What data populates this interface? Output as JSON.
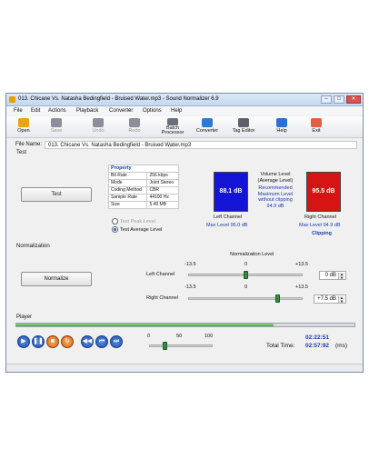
{
  "window": {
    "title": "013. Chicane Vs. Natasha Bedingfield - Bruised Water.mp3 - Sound Normalizer 6.9",
    "controls": [
      "–",
      "□",
      "✕"
    ]
  },
  "menu": [
    "File",
    "Edit",
    "Actions",
    "Playback",
    "Converter",
    "Options",
    "Help"
  ],
  "toolbar": [
    {
      "label": "Open",
      "icon": "folder-open-icon",
      "color": "#e8a317",
      "enabled": true
    },
    {
      "label": "Save",
      "icon": "save-icon",
      "color": "#8a8f99",
      "enabled": false
    },
    {
      "label": "Undo",
      "icon": "undo-icon",
      "color": "#8a8f99",
      "enabled": false
    },
    {
      "label": "Redo",
      "icon": "redo-icon",
      "color": "#8a8f99",
      "enabled": false
    },
    {
      "label": "Batch\nProcessor",
      "icon": "batch-icon",
      "color": "#6a6f7a",
      "enabled": true
    },
    {
      "label": "Converter",
      "icon": "converter-icon",
      "color": "#2b7bd6",
      "enabled": true
    },
    {
      "label": "Tag Editor",
      "icon": "tag-icon",
      "color": "#5a5f6a",
      "enabled": true
    },
    {
      "label": "Help",
      "icon": "help-icon",
      "color": "#2b6fd6",
      "enabled": true
    },
    {
      "label": "Exit",
      "icon": "exit-icon",
      "color": "#e06040",
      "enabled": true
    }
  ],
  "file": {
    "label": "File Name:",
    "value": "013. Chicane Vs. Natasha Bedingfield - Bruised Water.mp3"
  },
  "test": {
    "section": "Test",
    "button": "Test",
    "property_header": "Property",
    "properties": [
      {
        "name": "Bit Rate",
        "value": "256 kbps"
      },
      {
        "name": "Mode",
        "value": "Joint Stereo"
      },
      {
        "name": "Coding Method",
        "value": "CBR"
      },
      {
        "name": "Sample Rate",
        "value": "44100 Hz"
      },
      {
        "name": "Size",
        "value": "5.49 MB"
      }
    ],
    "radio_peak": "Test Peak Level",
    "radio_average": "Test Average Level",
    "left_meter": {
      "value": "88.1 dB",
      "color": "#1414d6",
      "label": "Left Channel",
      "max": "Max Level 95.0 dB"
    },
    "right_meter": {
      "value": "95.5 dB",
      "color": "#d61414",
      "label": "Right Channel",
      "max": "Max Level 94.9 dB",
      "clipping": "Clipping"
    },
    "volume_level": "Volume Level\n(Average Level)",
    "recommended": "Recommended\nMaximum Level\nwithout clipping\n94.9 dB"
  },
  "normalization": {
    "section": "Normalization",
    "button": "Normalize",
    "level_title": "Normalization Level",
    "left_label": "Left Channel",
    "right_label": "Right Channel",
    "min": "-13.5",
    "mid": "0",
    "max": "+13.5",
    "left_value": "0 dB",
    "right_value": "+7.5 dB",
    "left_level_db": 0,
    "right_level_db": 7.5
  },
  "player": {
    "section": "Player",
    "progress": 0.76,
    "volume_ticks": [
      "0",
      "50",
      "100"
    ],
    "volume": 0.25,
    "current_time": "02:22:51",
    "total_label": "Total Time:",
    "total_time": "02:57:92",
    "total_unit": "(ms)"
  }
}
